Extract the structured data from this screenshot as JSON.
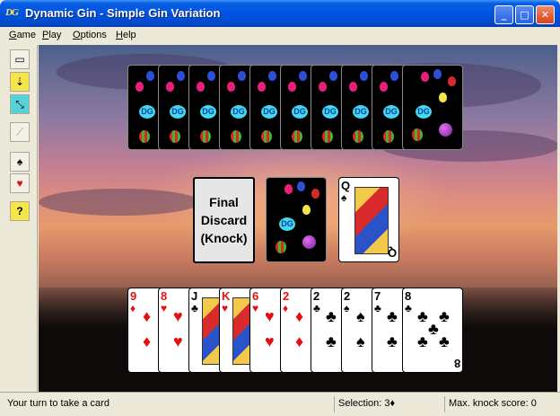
{
  "window": {
    "title": "Dynamic Gin - Simple Gin Variation",
    "icon_text": "DG",
    "icon": "dynamic-gin-icon"
  },
  "menu": [
    {
      "label": "Game",
      "accel": "G",
      "rest": "ame"
    },
    {
      "label": "Play",
      "accel": "P",
      "rest": "lay"
    },
    {
      "label": "Options",
      "accel": "O",
      "rest": "ptions"
    },
    {
      "label": "Help",
      "accel": "H",
      "rest": "elp"
    }
  ],
  "toolbar": [
    {
      "icon": "deal-icon",
      "glyph": "▭"
    },
    {
      "icon": "sort-icon",
      "glyph": "⇣"
    },
    {
      "icon": "hint-icon",
      "glyph": "⤡"
    },
    {
      "icon": "disabled-tool-icon",
      "glyph": "⟋"
    },
    {
      "icon": "cards-spade-icon",
      "glyph": "♠"
    },
    {
      "icon": "cards-heart-icon",
      "glyph": "♥"
    },
    {
      "icon": "help-icon",
      "glyph": "?"
    }
  ],
  "opponent_hand": {
    "card_count": 10,
    "back_label": "DG"
  },
  "discard_target": {
    "label": "Final\nDiscard\n(Knock)"
  },
  "stock_pile": {
    "back_label": "DG"
  },
  "discard_pile": {
    "rank": "Q",
    "suit": "♠"
  },
  "player_hand": [
    {
      "rank": "9",
      "suit": "♦",
      "color": "red"
    },
    {
      "rank": "8",
      "suit": "♥",
      "color": "red"
    },
    {
      "rank": "J",
      "suit": "♣",
      "color": "black"
    },
    {
      "rank": "K",
      "suit": "♥",
      "color": "red"
    },
    {
      "rank": "6",
      "suit": "♥",
      "color": "red"
    },
    {
      "rank": "2",
      "suit": "♦",
      "color": "red"
    },
    {
      "rank": "2",
      "suit": "♣",
      "color": "black"
    },
    {
      "rank": "2",
      "suit": "♠",
      "color": "black"
    },
    {
      "rank": "7",
      "suit": "♣",
      "color": "black"
    },
    {
      "rank": "8",
      "suit": "♣",
      "color": "black"
    }
  ],
  "status": {
    "message": "Your turn to take a card",
    "selection_label": "Selection:",
    "selection_value": "3♦",
    "knock_label": "Max. knock score:",
    "knock_value": "0"
  },
  "colors": {
    "titlebar": "#0054e3",
    "card_red": "#e41010",
    "card_back": "#000000",
    "dg_badge": "#41d8f0"
  }
}
